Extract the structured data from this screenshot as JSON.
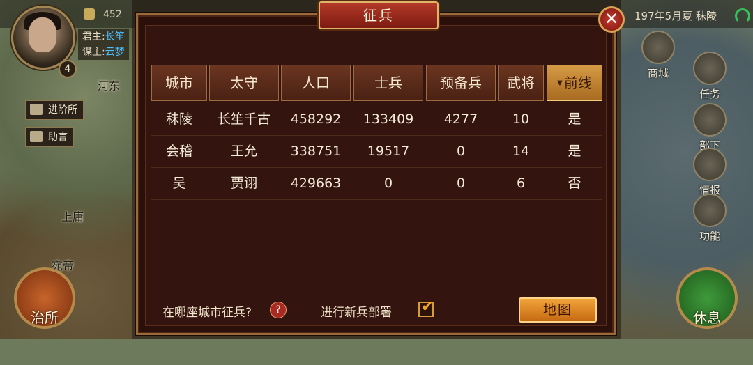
{
  "topbar": {
    "resource_1": "452",
    "lord_label": "君主:",
    "lord_name": "长笙",
    "advisor_label": "谋主:",
    "advisor_name": "云梦",
    "level": "4",
    "date": "197年5月夏 秣陵"
  },
  "map_labels": [
    "河东",
    "上庸",
    "宛帝"
  ],
  "left_menu": {
    "advance": "进阶所",
    "advice": "助言",
    "governance": "治所"
  },
  "right_menu": {
    "shop": "商城",
    "tasks": "任务",
    "subordinates": "部下",
    "intel": "情报",
    "functions": "功能",
    "rest": "休息"
  },
  "dialog": {
    "title": "征兵",
    "close_icon": "close-icon",
    "columns": [
      "城市",
      "太守",
      "人口",
      "士兵",
      "预备兵",
      "武将",
      "前线"
    ],
    "sorted_column": "前线",
    "rows": [
      {
        "city": "秣陵",
        "governor": "长笙千古",
        "population": "458292",
        "soldiers": "133409",
        "reserve": "4277",
        "generals": "10",
        "frontline": "是"
      },
      {
        "city": "会稽",
        "governor": "王允",
        "population": "338751",
        "soldiers": "19517",
        "reserve": "0",
        "generals": "14",
        "frontline": "是"
      },
      {
        "city": "吴",
        "governor": "贾诩",
        "population": "429663",
        "soldiers": "0",
        "reserve": "0",
        "generals": "6",
        "frontline": "否"
      }
    ],
    "question": "在哪座城市征兵?",
    "help_icon": "?",
    "deploy_label": "进行新兵部署",
    "deploy_checked": true,
    "map_button": "地图"
  },
  "colors": {
    "accent": "#f0a43a",
    "dialog_bg": "#34140f",
    "header": "#6a3520",
    "link": "#4fc0ff"
  }
}
